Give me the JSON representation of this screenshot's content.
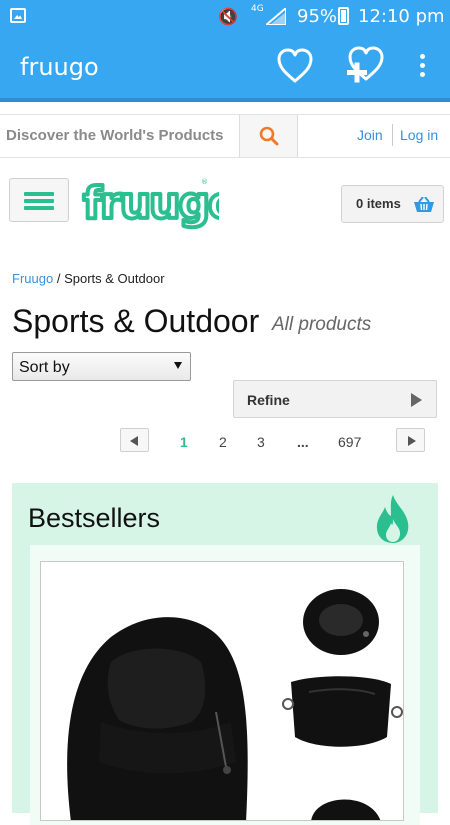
{
  "status_bar": {
    "network_label": "4G",
    "battery_percent": "95%",
    "time": "12:10 pm",
    "icons": [
      "image-icon",
      "mute-icon",
      "signal-icon",
      "battery-icon"
    ]
  },
  "app_bar": {
    "title": "fruugo",
    "icons": [
      "heart-icon",
      "heart-add-icon",
      "overflow-menu-icon"
    ]
  },
  "search": {
    "placeholder": "Discover the World's Products",
    "icon": "search-icon"
  },
  "account": {
    "join_label": "Join",
    "login_label": "Log in"
  },
  "header": {
    "logo_text": "fruugo",
    "basket_label": "0 items",
    "icons": [
      "hamburger-icon",
      "basket-icon"
    ]
  },
  "breadcrumb": {
    "root": "Fruugo",
    "separator": "/",
    "current": "Sports & Outdoor"
  },
  "page": {
    "title": "Sports & Outdoor",
    "subtitle": "All products"
  },
  "sort": {
    "selected": "Sort by"
  },
  "refine": {
    "label": "Refine"
  },
  "pagination": {
    "pages": [
      "1",
      "2",
      "3"
    ],
    "ellipsis": "...",
    "last_page": "697",
    "current": "1"
  },
  "bestsellers": {
    "title": "Bestsellers",
    "icon": "flame-icon"
  },
  "colors": {
    "app_bar": "#36a7f0",
    "brand_green": "#2bbf8f",
    "link_blue": "#3a8fd8",
    "bestsellers_bg": "#d7f5e6",
    "search_icon": "#f07a2a"
  }
}
